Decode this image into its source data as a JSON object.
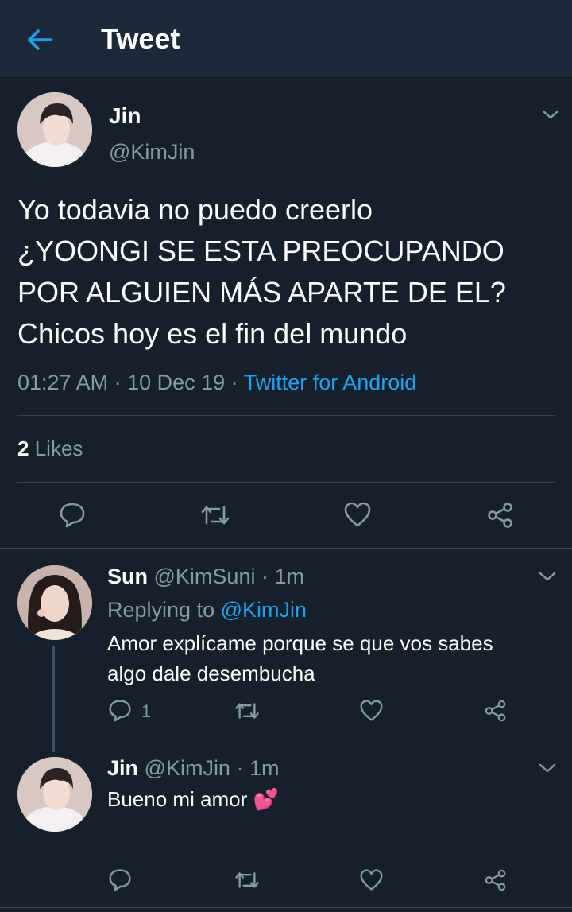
{
  "header": {
    "title": "Tweet",
    "back_icon": "arrow-left-icon"
  },
  "tweet": {
    "author_name": "Jin",
    "author_handle": "@KimJin",
    "text_lines": [
      "Yo todavia no puedo creerlo",
      "¿YOONGI SE ESTA PREOCUPANDO",
      "POR ALGUIEN MÁS APARTE DE EL?",
      "Chicos hoy es el fin del mundo"
    ],
    "time": "01:27 AM",
    "date": "10 Dec 19",
    "source": "Twitter for Android",
    "likes_count": "2",
    "likes_label": "Likes"
  },
  "replies": [
    {
      "name": "Sun",
      "handle": "@KimSuni",
      "time": "1m",
      "replying_prefix": "Replying to",
      "replying_handle": "@KimJin",
      "text_lines": [
        "Amor explícame porque se que vos sabes",
        "algo dale desembucha"
      ],
      "reply_count": "1"
    },
    {
      "name": "Jin",
      "handle": "@KimJin",
      "time": "1m",
      "text": "Bueno mi amor",
      "emoji": "💕"
    }
  ],
  "colors": {
    "background": "#15202b",
    "header_bg": "#1c2938",
    "accent": "#1da1f2",
    "muted": "#8899a6",
    "divider": "#38444d"
  }
}
